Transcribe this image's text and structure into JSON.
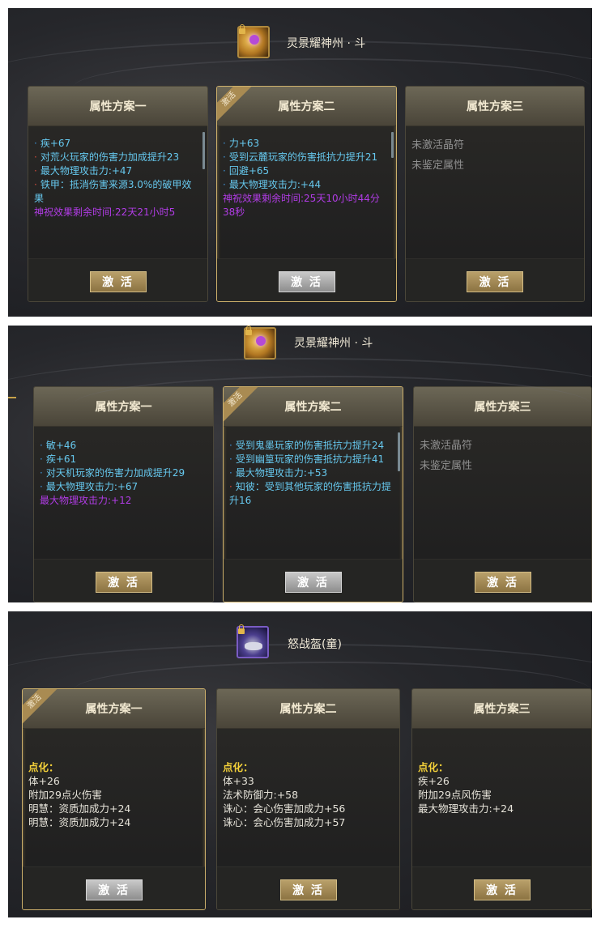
{
  "panel1": {
    "item_name": "灵景耀神州 · 斗",
    "schemes": [
      {
        "title": "属性方案一",
        "active": false,
        "lines": [
          {
            "bullet": "·",
            "text": "疾+67",
            "color": "blue"
          },
          {
            "bullet": "·",
            "text": "对荒火玩家的伤害力加成提升23",
            "color": "blue"
          },
          {
            "bullet": "·",
            "text": "最大物理攻击力:+47",
            "color": "blue"
          },
          {
            "bullet": "·",
            "text": "铁甲：抵消伤害来源3.0%的破甲效果",
            "color": "blue"
          },
          {
            "bullet": "",
            "text": "神祝效果剩余时间:22天21小时5",
            "color": "purple"
          }
        ],
        "button": "激 活"
      },
      {
        "title": "属性方案二",
        "active": true,
        "ribbon": "激活",
        "lines": [
          {
            "bullet": "·",
            "text": "力+63",
            "color": "blue"
          },
          {
            "bullet": "·",
            "text": "受到云麓玩家的伤害抵抗力提升21",
            "color": "blue"
          },
          {
            "bullet": "·",
            "text": "回避+65",
            "color": "blue"
          },
          {
            "bullet": "·",
            "text": "最大物理攻击力:+44",
            "color": "blue"
          },
          {
            "bullet": "",
            "text": "神祝效果剩余时间:25天10小时44分38秒",
            "color": "purple"
          }
        ],
        "button": "激 活"
      },
      {
        "title": "属性方案三",
        "active": false,
        "lines": [
          {
            "bullet": "",
            "text": "未激活晶符",
            "color": "grey"
          },
          {
            "bullet": "",
            "text": "未鉴定属性",
            "color": "grey"
          }
        ],
        "button": "激 活"
      }
    ]
  },
  "panel2": {
    "item_name": "灵景耀神州 · 斗",
    "schemes": [
      {
        "title": "属性方案一",
        "active": false,
        "lines": [
          {
            "bullet": "·",
            "text": "敏+46",
            "color": "blue"
          },
          {
            "bullet": "·",
            "text": "疾+61",
            "color": "blue"
          },
          {
            "bullet": "·",
            "text": "对天机玩家的伤害力加成提升29",
            "color": "blue"
          },
          {
            "bullet": "·",
            "text": "最大物理攻击力:+67",
            "color": "blue"
          },
          {
            "bullet": "",
            "text": "最大物理攻击力:+12",
            "color": "purple"
          }
        ],
        "button": "激 活"
      },
      {
        "title": "属性方案二",
        "active": true,
        "ribbon": "激活",
        "lines": [
          {
            "bullet": "·",
            "text": "受到鬼墨玩家的伤害抵抗力提升24",
            "color": "blue"
          },
          {
            "bullet": "·",
            "text": "受到幽篁玩家的伤害抵抗力提升41",
            "color": "blue"
          },
          {
            "bullet": "·",
            "text": "最大物理攻击力:+53",
            "color": "blue"
          },
          {
            "bullet": "·",
            "text": "知彼：受到其他玩家的伤害抵抗力提升16",
            "color": "blue",
            "bullet_color": "red"
          }
        ],
        "button": "激 活"
      },
      {
        "title": "属性方案三",
        "active": false,
        "lines": [
          {
            "bullet": "",
            "text": "未激活晶符",
            "color": "grey"
          },
          {
            "bullet": "",
            "text": "未鉴定属性",
            "color": "grey"
          }
        ],
        "button": "激 活"
      }
    ]
  },
  "panel3": {
    "item_name": "怒战盔(童)",
    "schemes": [
      {
        "title": "属性方案一",
        "active": true,
        "ribbon": "激活",
        "lines": [
          {
            "text": "点化：",
            "color": "yellow"
          },
          {
            "text": "体+26",
            "color": "white"
          },
          {
            "text": "附加29点火伤害",
            "color": "white"
          },
          {
            "text": "明慧：资质加成力+24",
            "color": "white"
          },
          {
            "text": "明慧：资质加成力+24",
            "color": "white"
          }
        ],
        "button": "激 活"
      },
      {
        "title": "属性方案二",
        "active": false,
        "lines": [
          {
            "text": "点化：",
            "color": "yellow"
          },
          {
            "text": "体+33",
            "color": "white"
          },
          {
            "text": "法术防御力:+58",
            "color": "white"
          },
          {
            "text": "诛心：会心伤害加成力+56",
            "color": "white"
          },
          {
            "text": "诛心：会心伤害加成力+57",
            "color": "white"
          }
        ],
        "button": "激 活"
      },
      {
        "title": "属性方案三",
        "active": false,
        "lines": [
          {
            "text": "点化：",
            "color": "yellow"
          },
          {
            "text": "疾+26",
            "color": "white"
          },
          {
            "text": "附加29点风伤害",
            "color": "white"
          },
          {
            "text": "最大物理攻击力:+24",
            "color": "white"
          }
        ],
        "button": "激 活"
      }
    ]
  }
}
